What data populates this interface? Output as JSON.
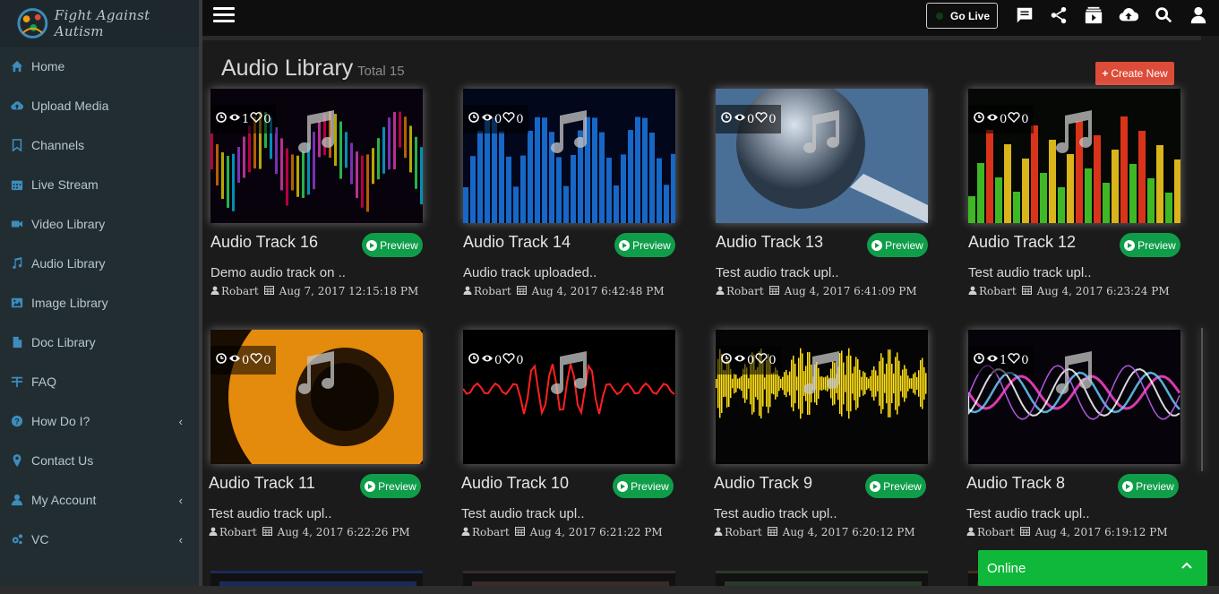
{
  "app": {
    "logo_text": "Fight Against Autism"
  },
  "sidebar": {
    "items": [
      {
        "label": "Home",
        "icon": "home-icon",
        "has_chevron": false
      },
      {
        "label": "Upload Media",
        "icon": "cloud-upload-icon",
        "has_chevron": false
      },
      {
        "label": "Channels",
        "icon": "bookmark-icon",
        "has_chevron": false
      },
      {
        "label": "Live Stream",
        "icon": "calendar-icon",
        "has_chevron": false
      },
      {
        "label": "Video Library",
        "icon": "video-camera-icon",
        "has_chevron": false
      },
      {
        "label": "Audio Library",
        "icon": "music-icon",
        "has_chevron": false
      },
      {
        "label": "Image Library",
        "icon": "image-icon",
        "has_chevron": false
      },
      {
        "label": "Doc Library",
        "icon": "document-icon",
        "has_chevron": false
      },
      {
        "label": "FAQ",
        "icon": "faq-icon",
        "has_chevron": false
      },
      {
        "label": "How Do I?",
        "icon": "question-icon",
        "has_chevron": true
      },
      {
        "label": "Contact Us",
        "icon": "map-marker-icon",
        "has_chevron": false
      },
      {
        "label": "My Account",
        "icon": "user-icon",
        "has_chevron": true
      },
      {
        "label": "VC",
        "icon": "cogs-icon",
        "has_chevron": true
      }
    ],
    "chevron": "‹"
  },
  "header": {
    "go_live_label": "Go Live",
    "icons": [
      "chat-icon",
      "share-icon",
      "playlist-icon",
      "cloud-upload-icon",
      "search-icon",
      "user-icon"
    ]
  },
  "page": {
    "title": "Audio Library",
    "total": "Total 15",
    "create_label": "Create New",
    "create_plus": "+"
  },
  "colors": {
    "sidebar_bg": "#222d32",
    "accent_blue": "#3c8dbc",
    "preview_green": "#0f9d4a",
    "create_red": "#dd4b39",
    "online_green": "#0fb83b"
  },
  "preview_label": "Preview",
  "cards": [
    {
      "title": "Audio Track 16",
      "desc": "Demo audio track on ..",
      "user": "Robart",
      "date": "Aug 7, 2017 12:15:18 PM",
      "views": "1",
      "likes": "0",
      "theme": "rainbow-wave"
    },
    {
      "title": "Audio Track 14",
      "desc": "Audio track uploaded..",
      "user": "Robart",
      "date": "Aug 4, 2017 6:42:48 PM",
      "views": "0",
      "likes": "0",
      "theme": "blue-equalizer"
    },
    {
      "title": "Audio Track 13",
      "desc": "Test audio track upl..",
      "user": "Robart",
      "date": "Aug 4, 2017 6:41:09 PM",
      "views": "0",
      "likes": "0",
      "theme": "microphone"
    },
    {
      "title": "Audio Track 12",
      "desc": "Test audio track upl..",
      "user": "Robart",
      "date": "Aug 4, 2017 6:23:24 PM",
      "views": "0",
      "likes": "0",
      "theme": "green-equalizer"
    },
    {
      "title": "Audio Track 11",
      "desc": "Test audio track upl..",
      "user": "Robart",
      "date": "Aug 4, 2017 6:22:26 PM",
      "views": "0",
      "likes": "0",
      "theme": "orange-speaker"
    },
    {
      "title": "Audio Track 10",
      "desc": "Test audio track upl..",
      "user": "Robart",
      "date": "Aug 4, 2017 6:21:22 PM",
      "views": "0",
      "likes": "0",
      "theme": "red-wave"
    },
    {
      "title": "Audio Track 9",
      "desc": "Test audio track upl..",
      "user": "Robart",
      "date": "Aug 4, 2017 6:20:12 PM",
      "views": "0",
      "likes": "0",
      "theme": "yellow-wave"
    },
    {
      "title": "Audio Track 8",
      "desc": "Test audio track upl..",
      "user": "Robart",
      "date": "Aug 4, 2017 6:19:12 PM",
      "views": "1",
      "likes": "0",
      "theme": "neon-wave"
    }
  ],
  "chat": {
    "status_label": "Online"
  }
}
